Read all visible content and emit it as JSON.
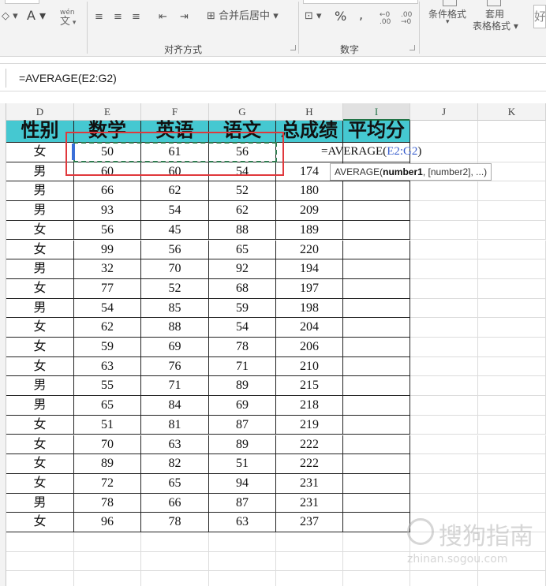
{
  "ribbon": {
    "font_color_button": "A",
    "pinyin_button": "wén\n文",
    "merge_center_label": "合并后居中",
    "percent_label": "%",
    "comma_label": ",",
    "increase_decimal_label": "←0\n.00",
    "decrease_decimal_label": ".00\n→0",
    "conditional_format_label": "条件格式",
    "table_format_label_1": "套用",
    "table_format_label_2": "表格格式",
    "good_style_label": "好",
    "group_alignment": "对齐方式",
    "group_number": "数字"
  },
  "formula_bar": {
    "content": "=AVERAGE(E2:G2)"
  },
  "columns": [
    "D",
    "E",
    "F",
    "G",
    "H",
    "I",
    "J",
    "K"
  ],
  "active_column": "I",
  "header_row": [
    "性别",
    "数学",
    "英语",
    "语文",
    "总成绩",
    "平均分"
  ],
  "rows": [
    [
      "女",
      "50",
      "61",
      "56",
      ""
    ],
    [
      "男",
      "60",
      "60",
      "54",
      "174"
    ],
    [
      "男",
      "66",
      "62",
      "52",
      "180"
    ],
    [
      "男",
      "93",
      "54",
      "62",
      "209"
    ],
    [
      "女",
      "56",
      "45",
      "88",
      "189"
    ],
    [
      "女",
      "99",
      "56",
      "65",
      "220"
    ],
    [
      "男",
      "32",
      "70",
      "92",
      "194"
    ],
    [
      "女",
      "77",
      "52",
      "68",
      "197"
    ],
    [
      "男",
      "54",
      "85",
      "59",
      "198"
    ],
    [
      "女",
      "62",
      "88",
      "54",
      "204"
    ],
    [
      "女",
      "59",
      "69",
      "78",
      "206"
    ],
    [
      "女",
      "63",
      "76",
      "71",
      "210"
    ],
    [
      "男",
      "55",
      "71",
      "89",
      "215"
    ],
    [
      "男",
      "65",
      "84",
      "69",
      "218"
    ],
    [
      "女",
      "51",
      "81",
      "87",
      "219"
    ],
    [
      "女",
      "70",
      "63",
      "89",
      "222"
    ],
    [
      "女",
      "89",
      "82",
      "51",
      "222"
    ],
    [
      "女",
      "72",
      "65",
      "94",
      "231"
    ],
    [
      "男",
      "78",
      "66",
      "87",
      "231"
    ],
    [
      "女",
      "96",
      "78",
      "63",
      "237"
    ]
  ],
  "editing_cell": {
    "prefix": "=AVERAGE(",
    "ref": "E2:G2",
    "suffix": ")"
  },
  "tooltip": {
    "func": "AVERAGE(",
    "arg1": "number1",
    "rest": ", [number2], ...)"
  },
  "watermark": {
    "main": "搜狗指南",
    "url": "zhinan.sogou.com"
  },
  "colors": {
    "header_fill": "#45c8d1",
    "selection_red": "#e0383c",
    "marquee_green": "#2f7a4f",
    "ref_blue": "#3a5fcd"
  }
}
